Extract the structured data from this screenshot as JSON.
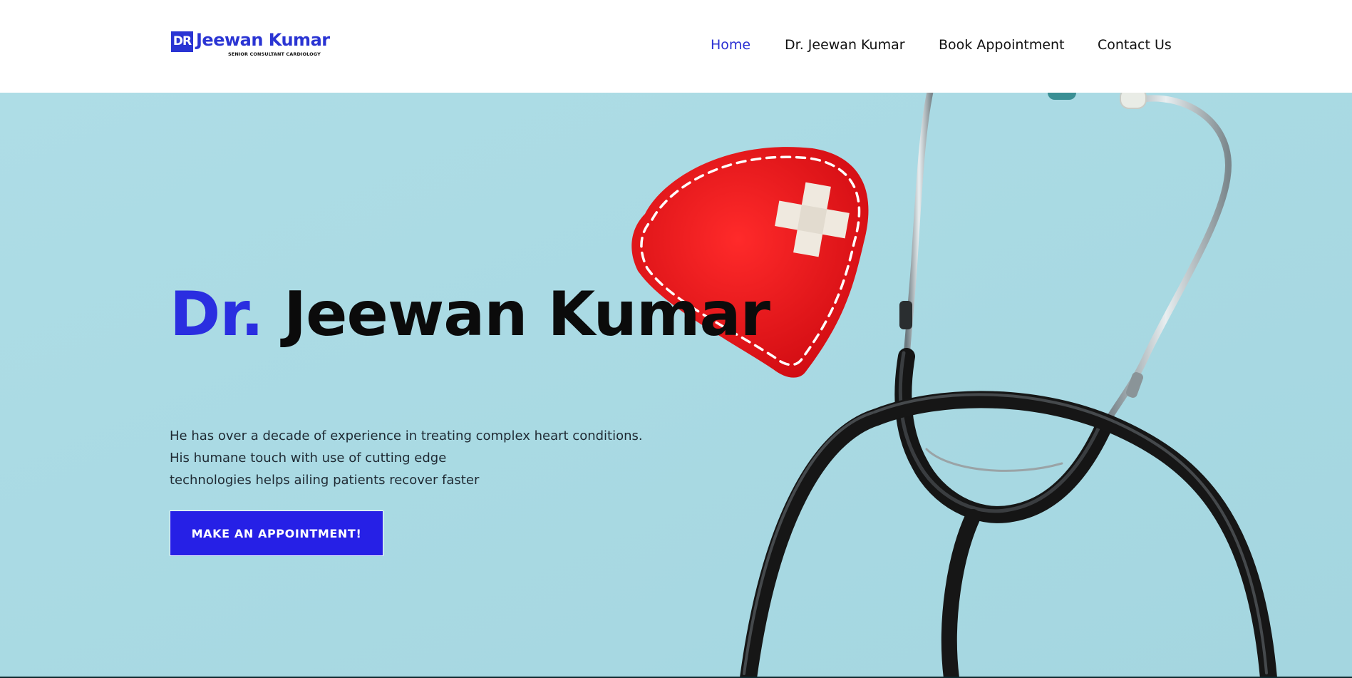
{
  "header": {
    "logo": {
      "badge": "DR",
      "name": "Jeewan Kumar",
      "tagline": "SENIOR CONSULTANT CARDIOLOGY"
    },
    "nav": [
      {
        "label": "Home",
        "active": true
      },
      {
        "label": "Dr. Jeewan Kumar",
        "active": false
      },
      {
        "label": "Book Appointment",
        "active": false
      },
      {
        "label": "Contact Us",
        "active": false
      }
    ]
  },
  "hero": {
    "title_prefix": "Dr.",
    "title_name": "Jeewan Kumar",
    "description_lines": [
      "He has over a decade of experience in treating complex heart conditions.",
      "His humane touch with use of cutting edge",
      "technologies helps ailing patients recover faster"
    ],
    "cta_label": "MAKE AN APPOINTMENT!",
    "image_icons": [
      "heart-icon",
      "stethoscope-icon"
    ]
  },
  "colors": {
    "brand_blue": "#2a2ee0",
    "hero_background": "#a9dbe4",
    "heart_red": "#e3161b",
    "stethoscope_black": "#111111"
  }
}
